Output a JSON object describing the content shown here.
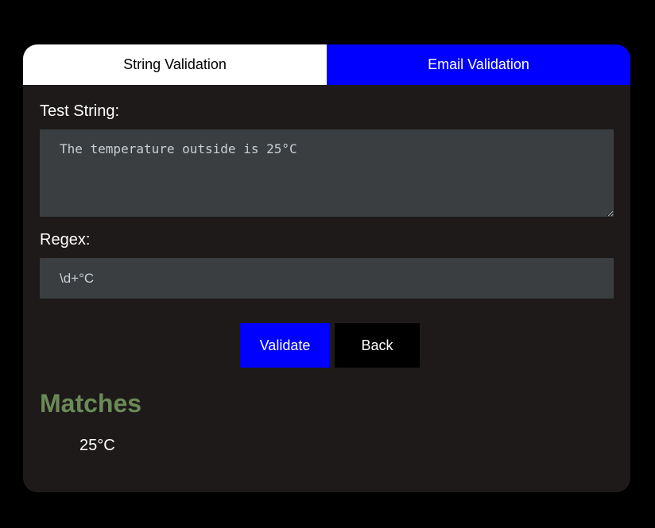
{
  "tabs": [
    {
      "label": "String Validation",
      "active": true
    },
    {
      "label": "Email Validation",
      "active": false
    }
  ],
  "form": {
    "test_string_label": "Test String:",
    "test_string_value": "The temperature outside is 25°C",
    "regex_label": "Regex:",
    "regex_value": "\\d+°C"
  },
  "buttons": {
    "validate_label": "Validate",
    "back_label": "Back"
  },
  "matches": {
    "title": "Matches",
    "items": [
      "25°C"
    ]
  },
  "colors": {
    "accent": "#0000ff",
    "card_background": "#1d1a19",
    "input_background": "#3a3e41",
    "matches_title": "#6b8a58"
  }
}
